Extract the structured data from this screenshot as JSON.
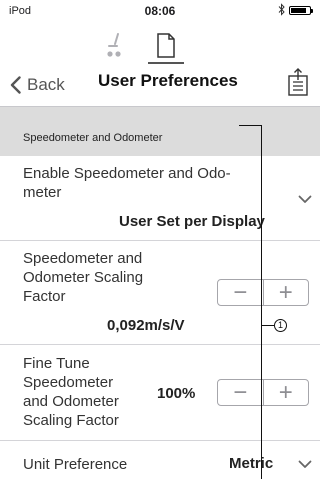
{
  "status_bar": {
    "carrier": "iPod",
    "time": "08:06",
    "bluetooth_icon": "bluetooth-icon",
    "battery_level": 0.85
  },
  "mode_switch": {
    "wheelchair_icon": "wheelchair-icon",
    "document_icon": "document-icon"
  },
  "nav": {
    "back_label": "Back",
    "title": "User Preferences",
    "export_icon": "export-icon"
  },
  "section": {
    "title": "Speedometer and Odometer"
  },
  "rows": {
    "enable": {
      "label": "Enable Speedometer and Odo-\nmeter",
      "value": "User Set per Display"
    },
    "scaling": {
      "label": "Speedometer and\nOdometer Scaling\nFactor",
      "value": "0,092m/s/V",
      "minus": "−",
      "plus": "+"
    },
    "fine_tune": {
      "label": "Fine Tune\nSpeedometer\nand Odometer\nScaling Factor",
      "value": "100%",
      "minus": "−",
      "plus": "+"
    },
    "unit": {
      "label": "Unit Preference",
      "value": "Metric"
    }
  },
  "callout": {
    "number": "1"
  },
  "colors": {
    "section_bg": "#dcdcdc",
    "separator": "#d4d4d8",
    "stepper_border": "#a6a6ab"
  }
}
